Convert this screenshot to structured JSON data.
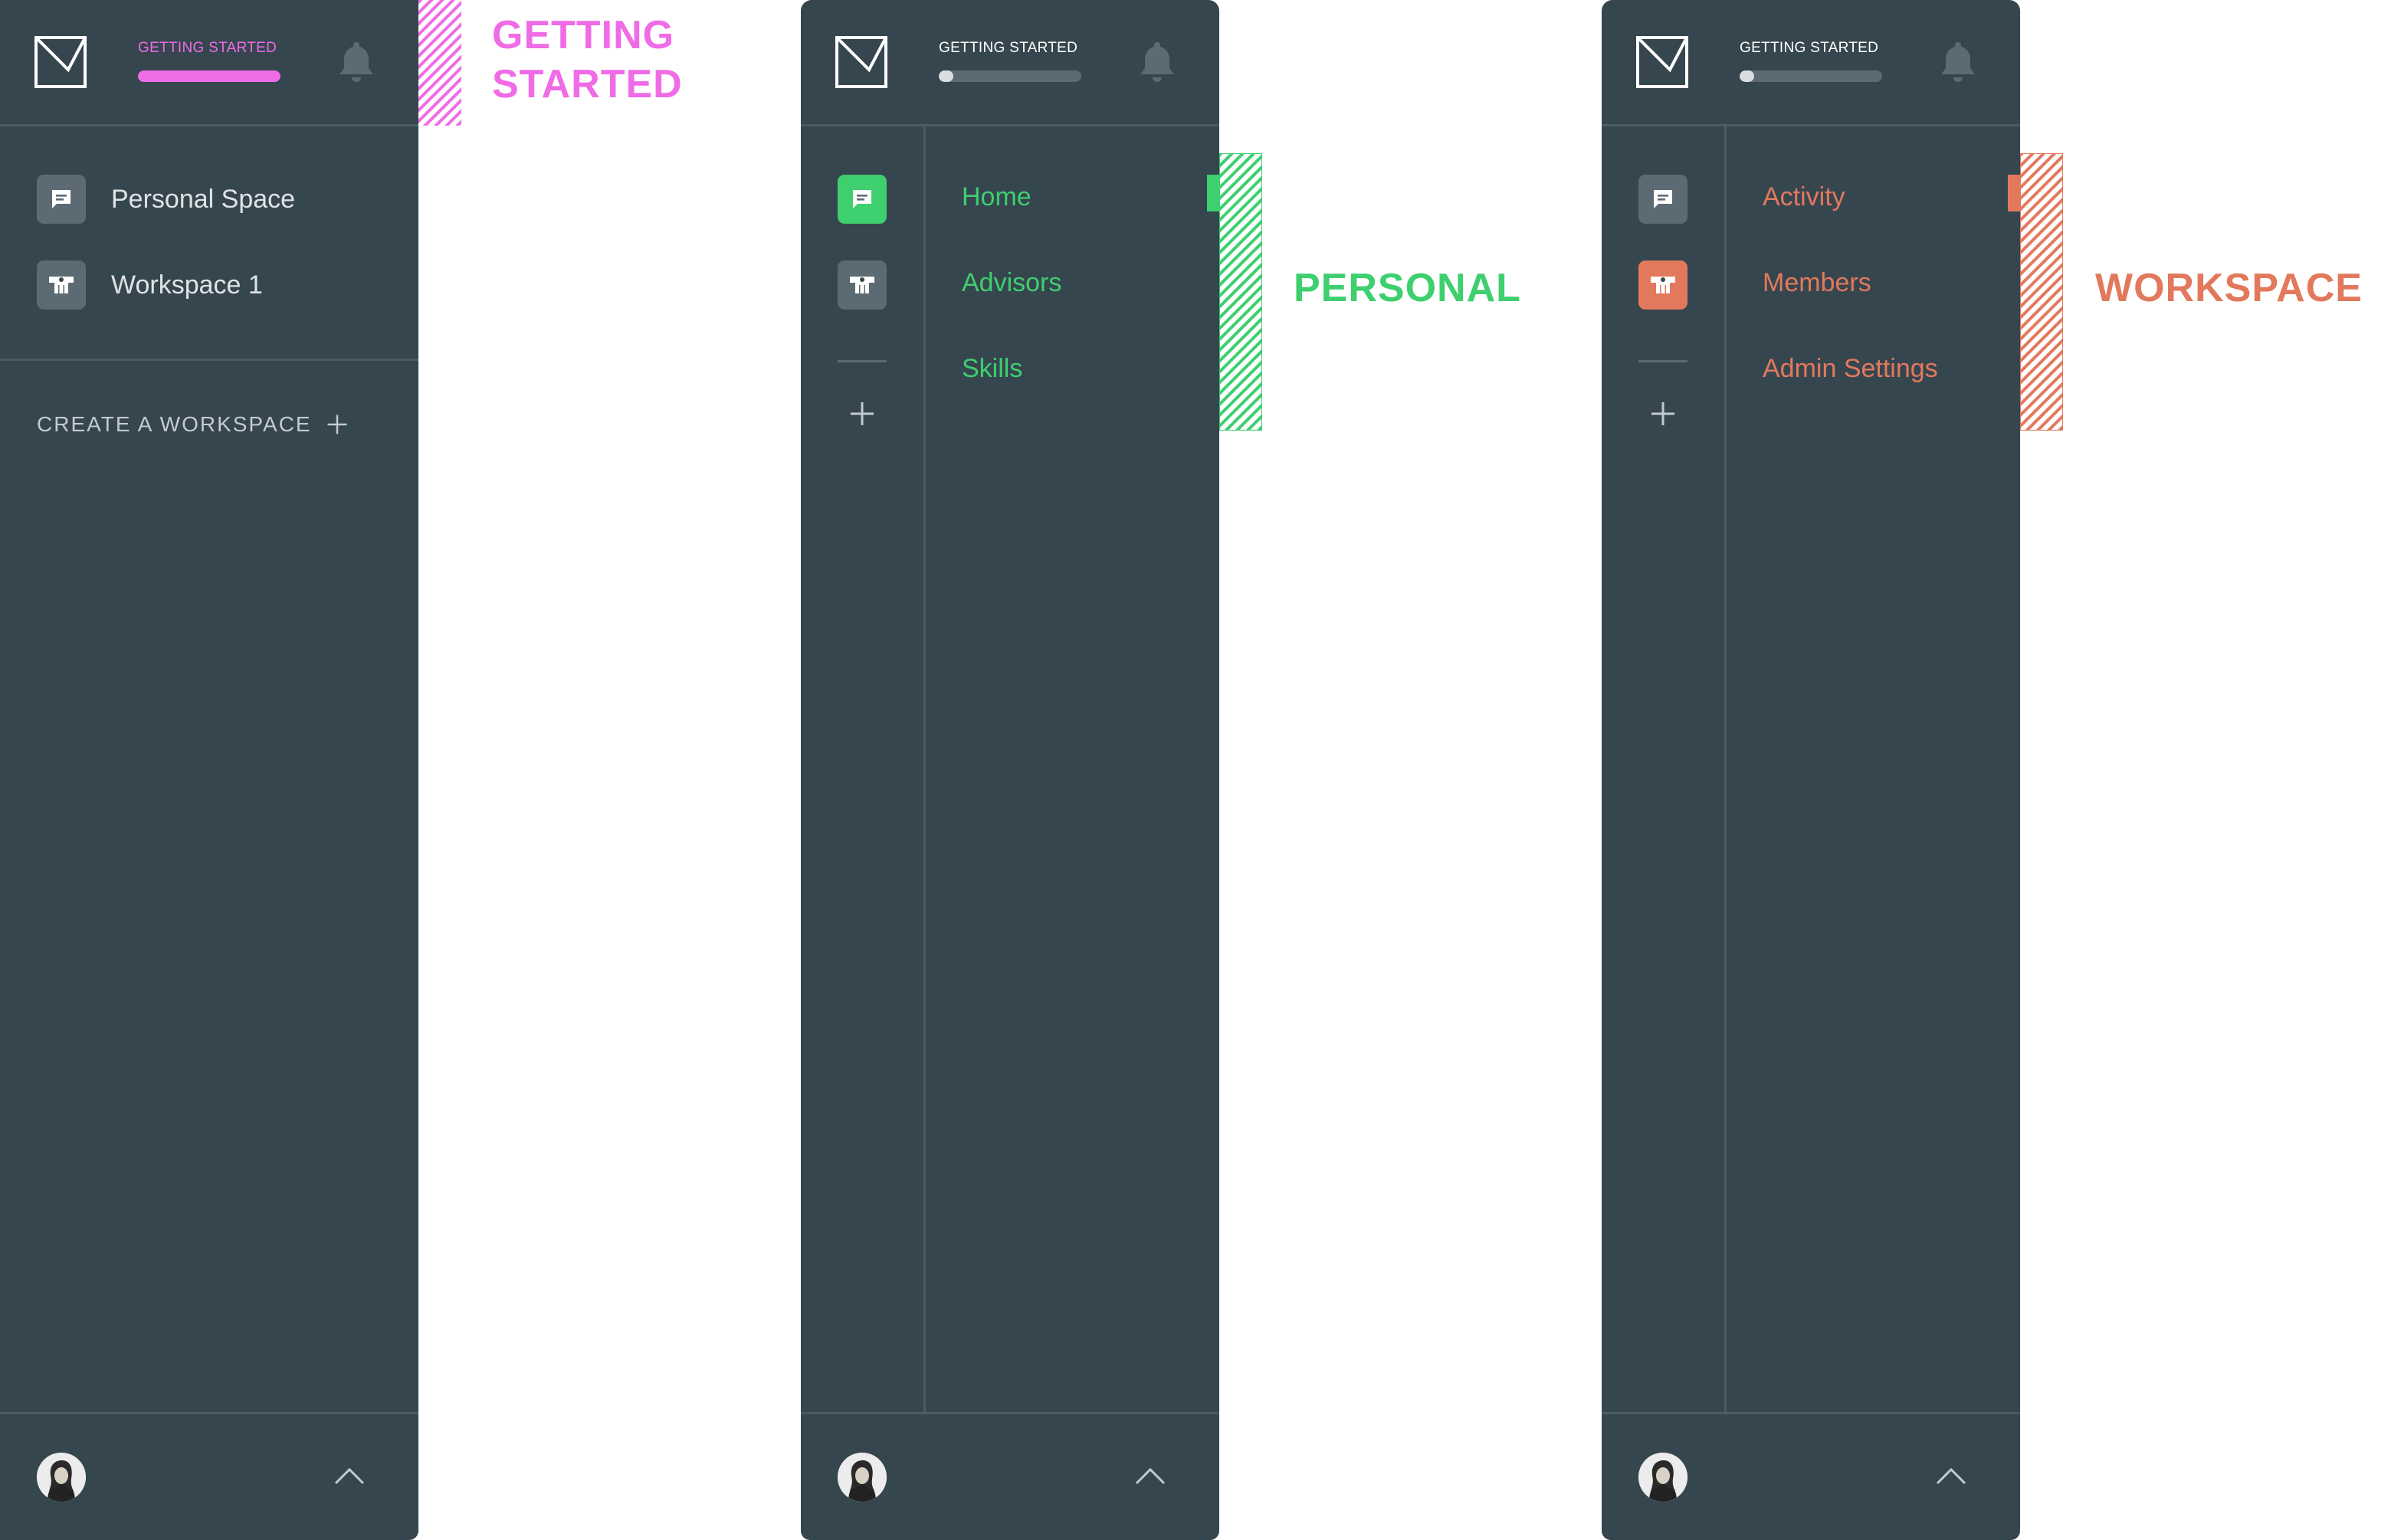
{
  "colors": {
    "panel_bg": "#36464f",
    "icon_bg": "#5c6b73",
    "getting_started_accent": "#f06be6",
    "personal_accent": "#3ecf6e",
    "workspace_accent": "#e2795d"
  },
  "panels": [
    {
      "header": {
        "getting_started_label": "GETTING STARTED",
        "progress": 1.0
      },
      "workspaces": [
        {
          "label": "Personal Space",
          "icon": "chat-icon"
        },
        {
          "label": "Workspace 1",
          "icon": "workspace-icon"
        }
      ],
      "create_workspace_label": "CREATE A WORKSPACE"
    },
    {
      "header": {
        "getting_started_label": "GETTING STARTED",
        "progress": 0.1
      },
      "nav": [
        "Home",
        "Advisors",
        "Skills"
      ]
    },
    {
      "header": {
        "getting_started_label": "GETTING STARTED",
        "progress": 0.1
      },
      "nav": [
        "Activity",
        "Members",
        "Admin Settings"
      ]
    }
  ],
  "callouts": {
    "getting_started": {
      "line1": "GETTING",
      "line2": "STARTED"
    },
    "personal": "PERSONAL",
    "workspace": "WORKSPACE"
  }
}
